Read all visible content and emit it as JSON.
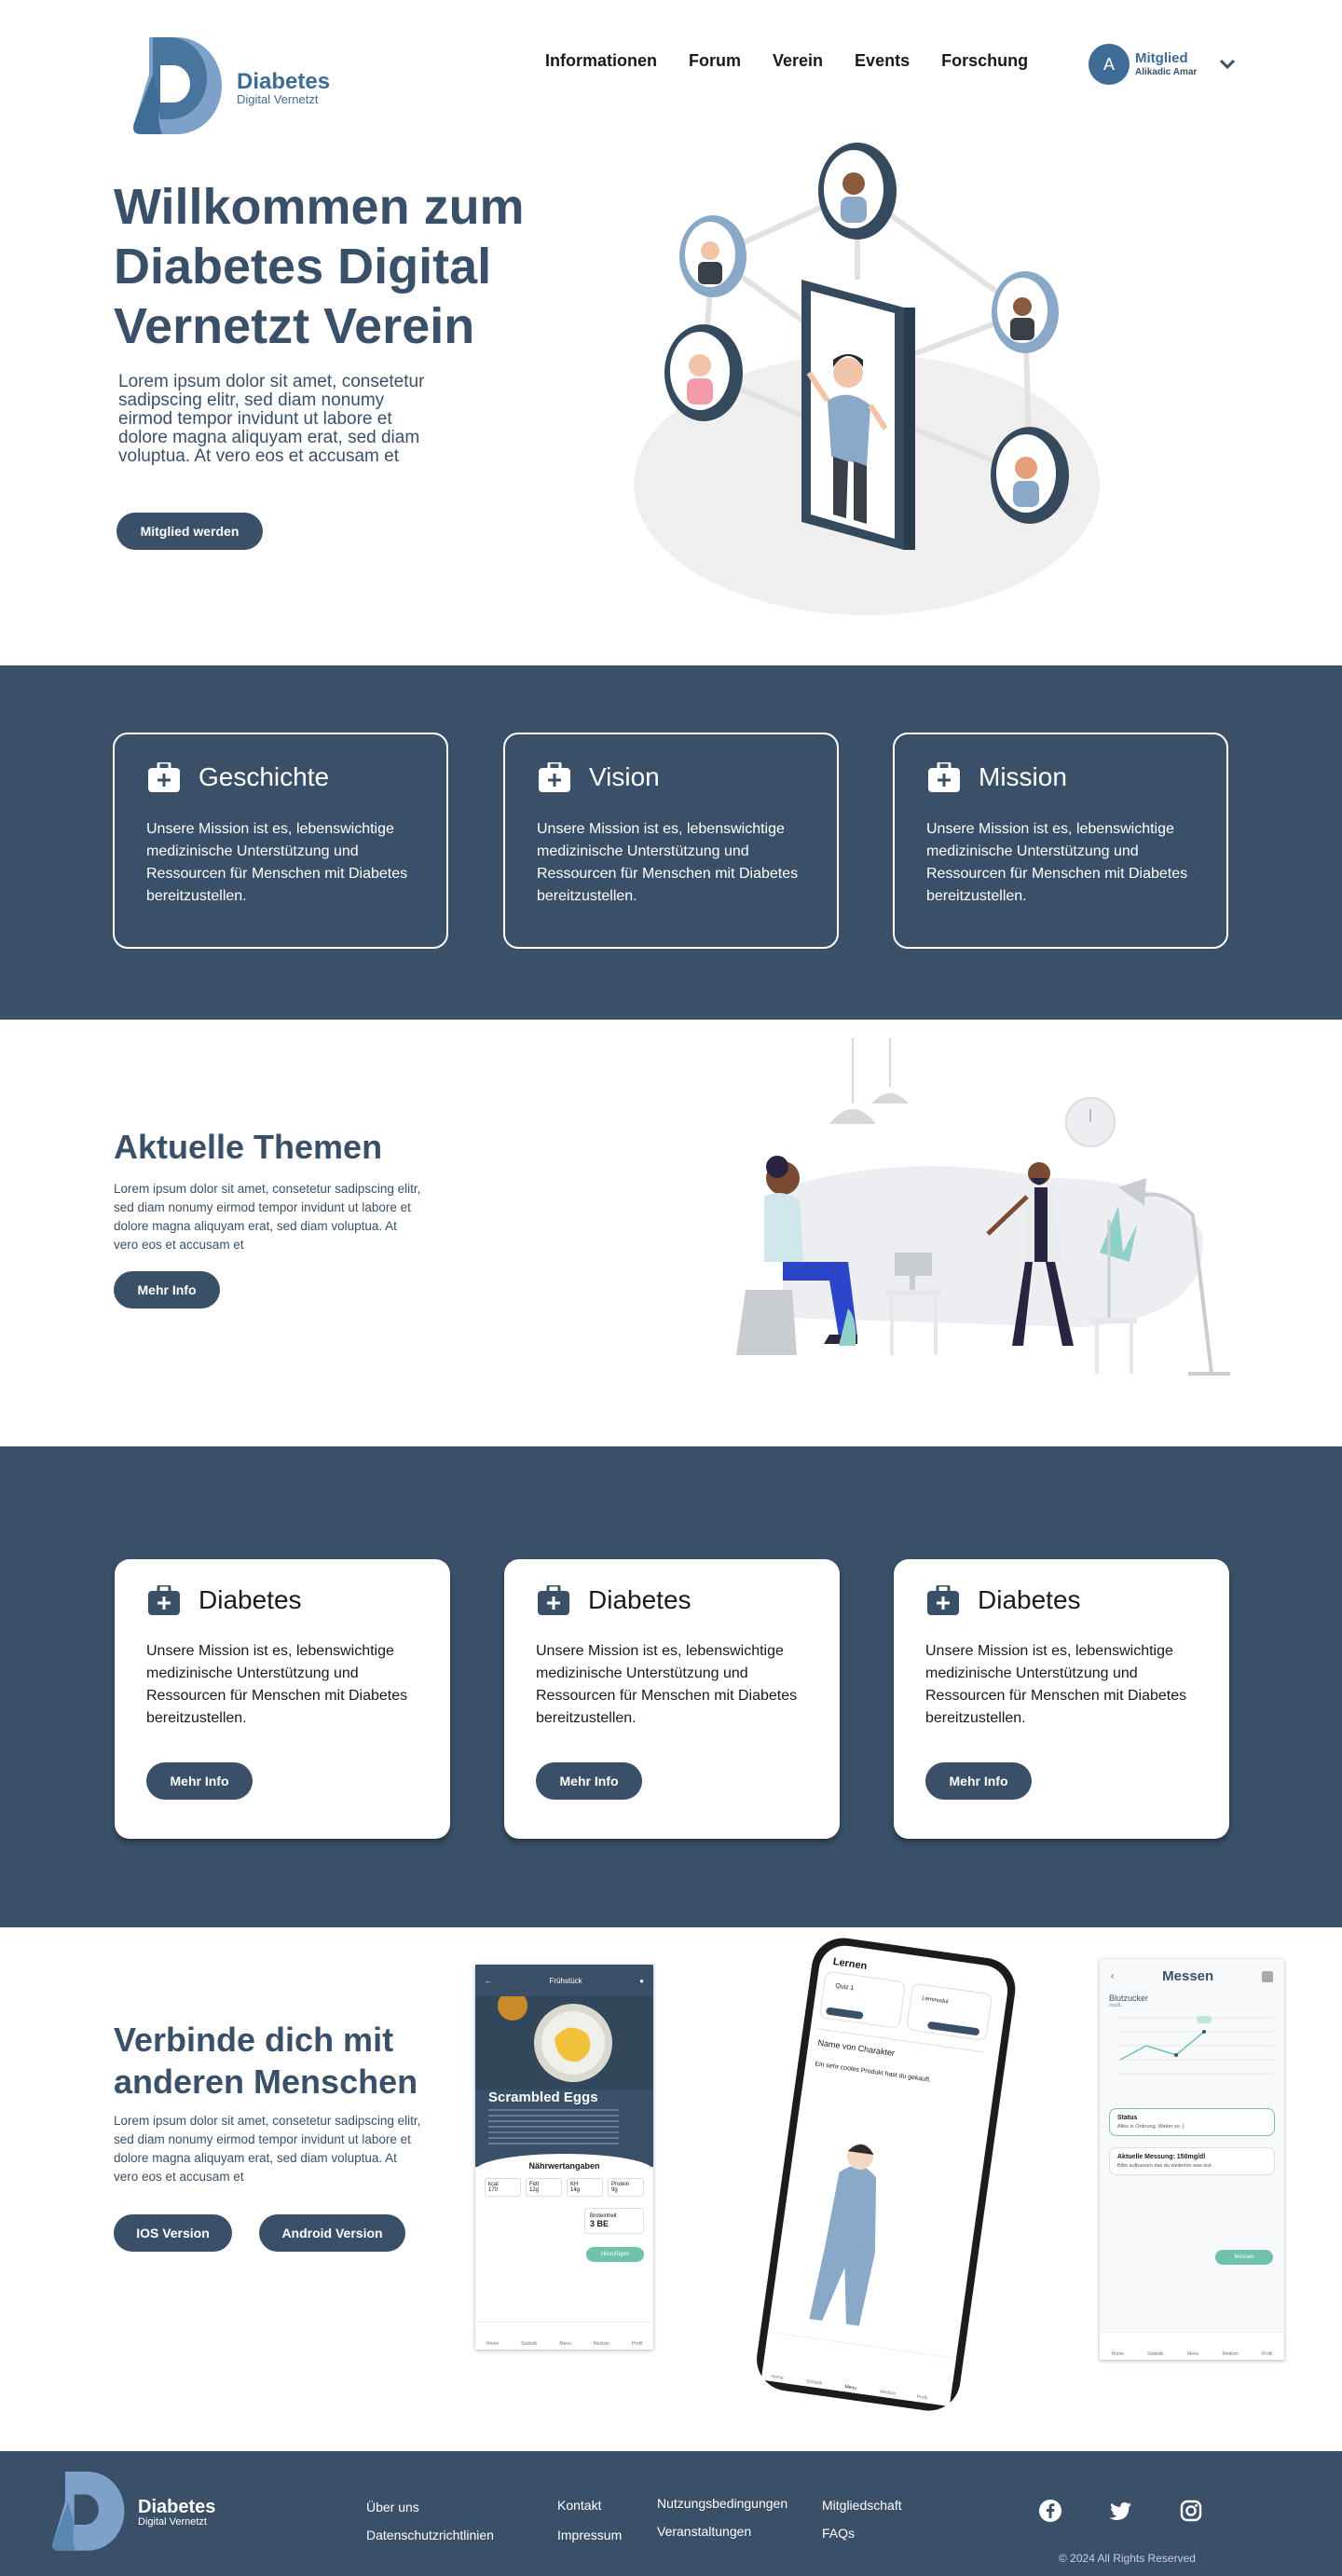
{
  "header": {
    "logo_line1": "Diabetes",
    "logo_line2": "Digital Vernetzt",
    "nav": [
      "Informationen",
      "Forum",
      "Verein",
      "Events",
      "Forschung"
    ],
    "user_initial": "A",
    "user_role": "Mitglied",
    "user_name": "Alikadic Amar"
  },
  "hero": {
    "title": "Willkommen zum Diabetes Digital Vernetzt Verein",
    "text": "Lorem ipsum dolor sit amet, consetetur sadipscing elitr, sed diam nonumy eirmod tempor invidunt ut labore et dolore magna aliquyam erat, sed diam voluptua. At vero eos et accusam et",
    "button": "Mitglied werden"
  },
  "values_cards": [
    {
      "title": "Geschichte",
      "text": "Unsere Mission ist es, lebenswichtige medizinische Unterstützung und Ressourcen für Menschen mit Diabetes bereitzustellen."
    },
    {
      "title": "Vision",
      "text": "Unsere Mission ist es, lebenswichtige medizinische Unterstützung und Ressourcen für Menschen mit Diabetes bereitzustellen."
    },
    {
      "title": "Mission",
      "text": "Unsere Mission ist es, lebenswichtige medizinische Unterstützung und Ressourcen für Menschen mit Diabetes bereitzustellen."
    }
  ],
  "topics": {
    "title": "Aktuelle Themen",
    "text": "Lorem ipsum dolor sit amet, consetetur sadipscing elitr, sed diam nonumy eirmod tempor invidunt ut labore et dolore magna aliquyam erat, sed diam voluptua. At vero eos et accusam et",
    "button": "Mehr Info"
  },
  "info_cards": [
    {
      "title": "Diabetes",
      "text": "Unsere Mission ist es, lebenswichtige medizinische Unterstützung und Ressourcen für Menschen mit Diabetes bereitzustellen.",
      "button": "Mehr Info"
    },
    {
      "title": "Diabetes",
      "text": "Unsere Mission ist es, lebenswichtige medizinische Unterstützung und Ressourcen für Menschen mit Diabetes bereitzustellen.",
      "button": "Mehr Info"
    },
    {
      "title": "Diabetes",
      "text": "Unsere Mission ist es, lebenswichtige medizinische Unterstützung und Ressourcen für Menschen mit Diabetes bereitzustellen.",
      "button": "Mehr Info"
    }
  ],
  "connect": {
    "title": "Verbinde dich mit anderen Menschen",
    "text": "Lorem ipsum dolor sit amet, consetetur sadipscing elitr, sed diam nonumy eirmod tempor invidunt ut labore et dolore magna aliquyam erat, sed diam voluptua. At vero eos et accusam et",
    "button_ios": "IOS Version",
    "button_android": "Android Version"
  },
  "phone_a": {
    "header": "Frühstück",
    "dish": "Scrambled Eggs",
    "nutrition_title": "Nährwertangaben",
    "nutrition": [
      [
        "kcal",
        "170"
      ],
      [
        "Fett",
        "12g"
      ],
      [
        "KH",
        "14g"
      ],
      [
        "Protein",
        "9g"
      ]
    ],
    "be_label": "Broteinheit",
    "be_value": "3 BE",
    "action": "Hinzufügen",
    "tabs": [
      "Home",
      "Statistik",
      "Menu",
      "Medizin",
      "Profil"
    ]
  },
  "phone_b": {
    "header": "Lernen",
    "quiz": "Quiz 1",
    "tile2": "Lernmodul",
    "character_label": "Name von Charakter",
    "comment": "Ein sehr cooles Produkt hast du gekauft.",
    "tabs": [
      "Home",
      "Statistik",
      "Menu",
      "Medizin",
      "Profil"
    ]
  },
  "phone_c": {
    "header": "Messen",
    "chart_label": "Blutzucker",
    "chart_unit": "mg/dL",
    "status_label": "Status",
    "status_text": "Alles in Ordnung. Weiter so :)",
    "measure_label": "Aktuelle Messung: 150mg/dl",
    "measure_text": "Bitte aufpassen das du weiterhin was isst.",
    "action": "Messen",
    "tabs": [
      "Home",
      "Statistik",
      "Menu",
      "Medizin",
      "Profil"
    ]
  },
  "footer": {
    "logo_line1": "Diabetes",
    "logo_line2": "Digital Vernetzt",
    "links": {
      "about": "Über uns",
      "privacy": "Datenschutzrichtlinien",
      "contact": "Kontakt",
      "imprint": "Impressum",
      "terms": "Nutzungsbedingungen",
      "events": "Veranstaltungen",
      "membership": "Mitgliedschaft",
      "faq": "FAQs"
    },
    "copyright": "© 2024 All Rights Reserved"
  },
  "colors": {
    "navy": "#3a5068",
    "brand_blue": "#3f6c97",
    "light_blue": "#8aa8c8",
    "accent_teal": "#6fc3ad"
  }
}
